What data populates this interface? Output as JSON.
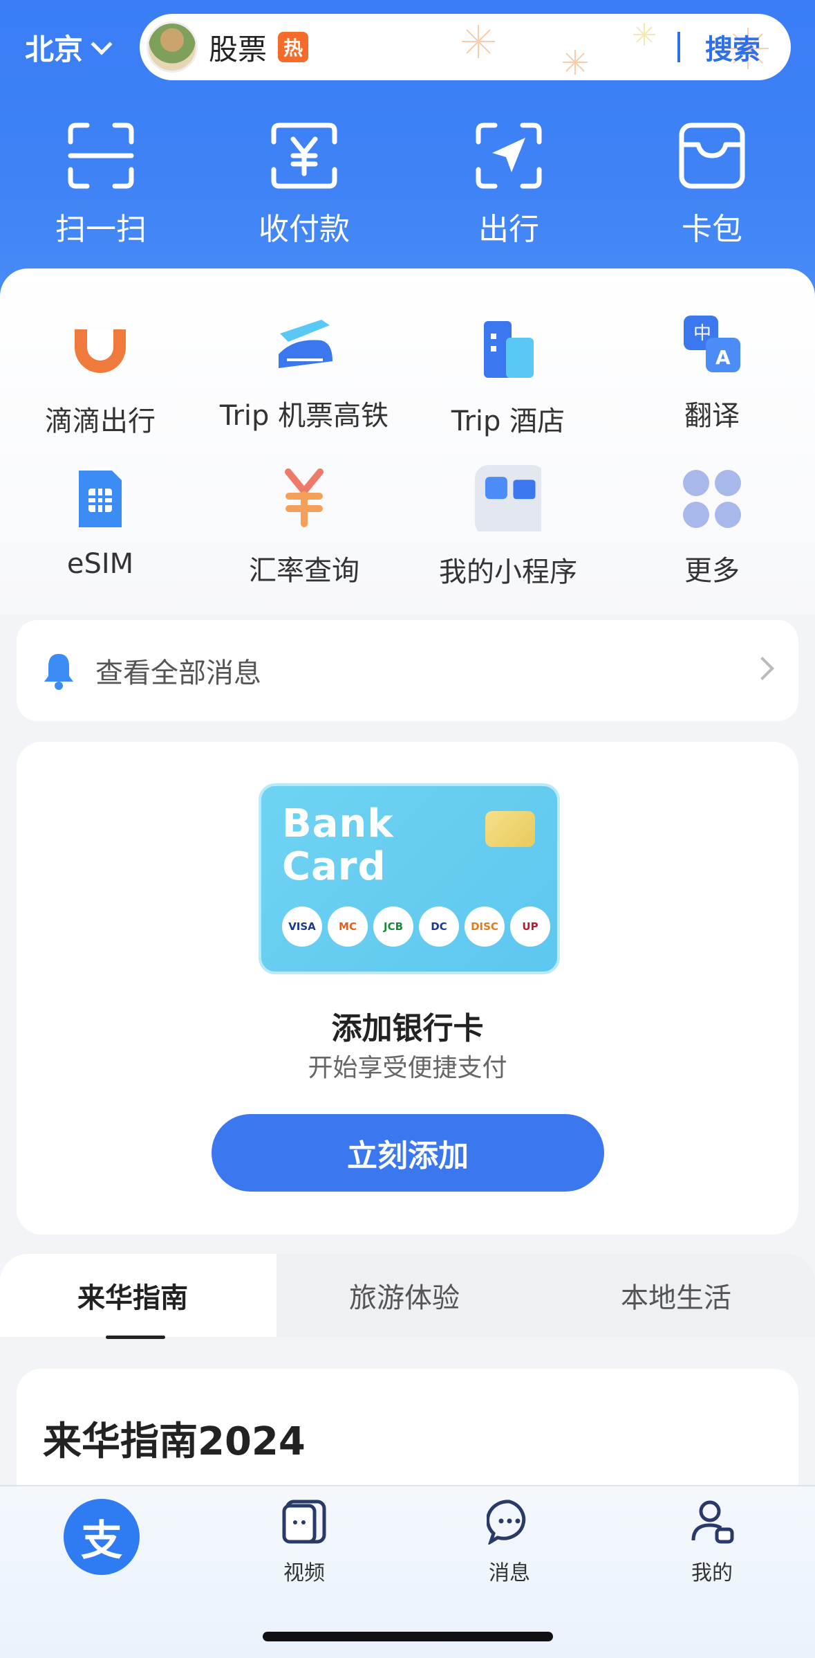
{
  "header": {
    "city": "北京",
    "search_keyword": "股票",
    "hot_badge": "热",
    "search_button": "搜索"
  },
  "quick_actions": [
    {
      "label": "扫一扫",
      "icon": "scan-icon"
    },
    {
      "label": "收付款",
      "icon": "pay-receive-icon"
    },
    {
      "label": "出行",
      "icon": "travel-icon"
    },
    {
      "label": "卡包",
      "icon": "wallet-icon"
    }
  ],
  "services": [
    {
      "label": "滴滴出行",
      "icon": "didi-icon"
    },
    {
      "label": "Trip 机票高铁",
      "icon": "flight-train-icon"
    },
    {
      "label": "Trip 酒店",
      "icon": "hotel-icon"
    },
    {
      "label": "翻译",
      "icon": "translate-icon"
    },
    {
      "label": "eSIM",
      "icon": "esim-icon"
    },
    {
      "label": "汇率查询",
      "icon": "exchange-rate-icon"
    },
    {
      "label": "我的小程序",
      "icon": "mini-programs-icon"
    },
    {
      "label": "更多",
      "icon": "more-icon"
    }
  ],
  "messages": {
    "label": "查看全部消息"
  },
  "bank_card": {
    "card_text": "Bank Card",
    "card_line1": "Bank",
    "card_line2": "Card",
    "logos": [
      "VISA",
      "MC",
      "JCB",
      "DC",
      "DISC",
      "UP"
    ],
    "title": "添加银行卡",
    "subtitle": "开始享受便捷支付",
    "button": "立刻添加"
  },
  "tabs": [
    {
      "label": "来华指南",
      "active": true
    },
    {
      "label": "旅游体验",
      "active": false
    },
    {
      "label": "本地生活",
      "active": false
    }
  ],
  "guide": {
    "title": "来华指南2024"
  },
  "bottom_nav": [
    {
      "label": "支",
      "icon": "alipay-home-icon"
    },
    {
      "label": "视频",
      "icon": "video-icon"
    },
    {
      "label": "消息",
      "icon": "message-icon"
    },
    {
      "label": "我的",
      "icon": "profile-icon"
    }
  ],
  "colors": {
    "brand_blue": "#3b78f0",
    "header_blue": "#3f83f6",
    "hot_orange": "#f56b2a"
  }
}
